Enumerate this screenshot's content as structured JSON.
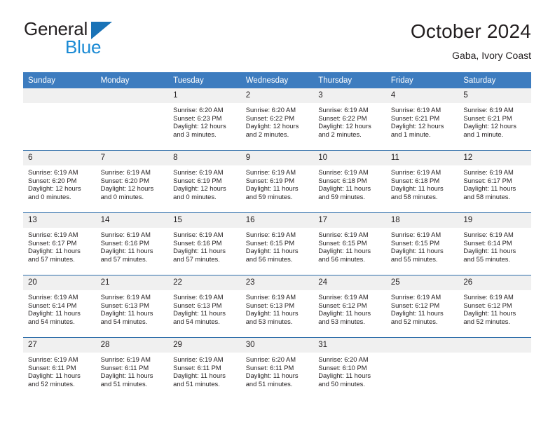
{
  "brand": {
    "name_part1": "General",
    "name_part2": "Blue",
    "triangle_color": "#1a73b7",
    "blue_color": "#1a8ad4"
  },
  "header": {
    "title": "October 2024",
    "subtitle": "Gaba, Ivory Coast"
  },
  "theme": {
    "header_bg": "#3d7cbf",
    "row_border": "#2c6ca8",
    "daynum_bg": "#f0f0f0",
    "text": "#231f20"
  },
  "calendar": {
    "weekdays": [
      "Sunday",
      "Monday",
      "Tuesday",
      "Wednesday",
      "Thursday",
      "Friday",
      "Saturday"
    ],
    "weeks": [
      [
        {
          "day": "",
          "empty": true
        },
        {
          "day": "",
          "empty": true
        },
        {
          "day": "1",
          "sunrise": "Sunrise: 6:20 AM",
          "sunset": "Sunset: 6:23 PM",
          "daylight_l1": "Daylight: 12 hours",
          "daylight_l2": "and 3 minutes."
        },
        {
          "day": "2",
          "sunrise": "Sunrise: 6:20 AM",
          "sunset": "Sunset: 6:22 PM",
          "daylight_l1": "Daylight: 12 hours",
          "daylight_l2": "and 2 minutes."
        },
        {
          "day": "3",
          "sunrise": "Sunrise: 6:19 AM",
          "sunset": "Sunset: 6:22 PM",
          "daylight_l1": "Daylight: 12 hours",
          "daylight_l2": "and 2 minutes."
        },
        {
          "day": "4",
          "sunrise": "Sunrise: 6:19 AM",
          "sunset": "Sunset: 6:21 PM",
          "daylight_l1": "Daylight: 12 hours",
          "daylight_l2": "and 1 minute."
        },
        {
          "day": "5",
          "sunrise": "Sunrise: 6:19 AM",
          "sunset": "Sunset: 6:21 PM",
          "daylight_l1": "Daylight: 12 hours",
          "daylight_l2": "and 1 minute."
        }
      ],
      [
        {
          "day": "6",
          "sunrise": "Sunrise: 6:19 AM",
          "sunset": "Sunset: 6:20 PM",
          "daylight_l1": "Daylight: 12 hours",
          "daylight_l2": "and 0 minutes."
        },
        {
          "day": "7",
          "sunrise": "Sunrise: 6:19 AM",
          "sunset": "Sunset: 6:20 PM",
          "daylight_l1": "Daylight: 12 hours",
          "daylight_l2": "and 0 minutes."
        },
        {
          "day": "8",
          "sunrise": "Sunrise: 6:19 AM",
          "sunset": "Sunset: 6:19 PM",
          "daylight_l1": "Daylight: 12 hours",
          "daylight_l2": "and 0 minutes."
        },
        {
          "day": "9",
          "sunrise": "Sunrise: 6:19 AM",
          "sunset": "Sunset: 6:19 PM",
          "daylight_l1": "Daylight: 11 hours",
          "daylight_l2": "and 59 minutes."
        },
        {
          "day": "10",
          "sunrise": "Sunrise: 6:19 AM",
          "sunset": "Sunset: 6:18 PM",
          "daylight_l1": "Daylight: 11 hours",
          "daylight_l2": "and 59 minutes."
        },
        {
          "day": "11",
          "sunrise": "Sunrise: 6:19 AM",
          "sunset": "Sunset: 6:18 PM",
          "daylight_l1": "Daylight: 11 hours",
          "daylight_l2": "and 58 minutes."
        },
        {
          "day": "12",
          "sunrise": "Sunrise: 6:19 AM",
          "sunset": "Sunset: 6:17 PM",
          "daylight_l1": "Daylight: 11 hours",
          "daylight_l2": "and 58 minutes."
        }
      ],
      [
        {
          "day": "13",
          "sunrise": "Sunrise: 6:19 AM",
          "sunset": "Sunset: 6:17 PM",
          "daylight_l1": "Daylight: 11 hours",
          "daylight_l2": "and 57 minutes."
        },
        {
          "day": "14",
          "sunrise": "Sunrise: 6:19 AM",
          "sunset": "Sunset: 6:16 PM",
          "daylight_l1": "Daylight: 11 hours",
          "daylight_l2": "and 57 minutes."
        },
        {
          "day": "15",
          "sunrise": "Sunrise: 6:19 AM",
          "sunset": "Sunset: 6:16 PM",
          "daylight_l1": "Daylight: 11 hours",
          "daylight_l2": "and 57 minutes."
        },
        {
          "day": "16",
          "sunrise": "Sunrise: 6:19 AM",
          "sunset": "Sunset: 6:15 PM",
          "daylight_l1": "Daylight: 11 hours",
          "daylight_l2": "and 56 minutes."
        },
        {
          "day": "17",
          "sunrise": "Sunrise: 6:19 AM",
          "sunset": "Sunset: 6:15 PM",
          "daylight_l1": "Daylight: 11 hours",
          "daylight_l2": "and 56 minutes."
        },
        {
          "day": "18",
          "sunrise": "Sunrise: 6:19 AM",
          "sunset": "Sunset: 6:15 PM",
          "daylight_l1": "Daylight: 11 hours",
          "daylight_l2": "and 55 minutes."
        },
        {
          "day": "19",
          "sunrise": "Sunrise: 6:19 AM",
          "sunset": "Sunset: 6:14 PM",
          "daylight_l1": "Daylight: 11 hours",
          "daylight_l2": "and 55 minutes."
        }
      ],
      [
        {
          "day": "20",
          "sunrise": "Sunrise: 6:19 AM",
          "sunset": "Sunset: 6:14 PM",
          "daylight_l1": "Daylight: 11 hours",
          "daylight_l2": "and 54 minutes."
        },
        {
          "day": "21",
          "sunrise": "Sunrise: 6:19 AM",
          "sunset": "Sunset: 6:13 PM",
          "daylight_l1": "Daylight: 11 hours",
          "daylight_l2": "and 54 minutes."
        },
        {
          "day": "22",
          "sunrise": "Sunrise: 6:19 AM",
          "sunset": "Sunset: 6:13 PM",
          "daylight_l1": "Daylight: 11 hours",
          "daylight_l2": "and 54 minutes."
        },
        {
          "day": "23",
          "sunrise": "Sunrise: 6:19 AM",
          "sunset": "Sunset: 6:13 PM",
          "daylight_l1": "Daylight: 11 hours",
          "daylight_l2": "and 53 minutes."
        },
        {
          "day": "24",
          "sunrise": "Sunrise: 6:19 AM",
          "sunset": "Sunset: 6:12 PM",
          "daylight_l1": "Daylight: 11 hours",
          "daylight_l2": "and 53 minutes."
        },
        {
          "day": "25",
          "sunrise": "Sunrise: 6:19 AM",
          "sunset": "Sunset: 6:12 PM",
          "daylight_l1": "Daylight: 11 hours",
          "daylight_l2": "and 52 minutes."
        },
        {
          "day": "26",
          "sunrise": "Sunrise: 6:19 AM",
          "sunset": "Sunset: 6:12 PM",
          "daylight_l1": "Daylight: 11 hours",
          "daylight_l2": "and 52 minutes."
        }
      ],
      [
        {
          "day": "27",
          "sunrise": "Sunrise: 6:19 AM",
          "sunset": "Sunset: 6:11 PM",
          "daylight_l1": "Daylight: 11 hours",
          "daylight_l2": "and 52 minutes."
        },
        {
          "day": "28",
          "sunrise": "Sunrise: 6:19 AM",
          "sunset": "Sunset: 6:11 PM",
          "daylight_l1": "Daylight: 11 hours",
          "daylight_l2": "and 51 minutes."
        },
        {
          "day": "29",
          "sunrise": "Sunrise: 6:19 AM",
          "sunset": "Sunset: 6:11 PM",
          "daylight_l1": "Daylight: 11 hours",
          "daylight_l2": "and 51 minutes."
        },
        {
          "day": "30",
          "sunrise": "Sunrise: 6:20 AM",
          "sunset": "Sunset: 6:11 PM",
          "daylight_l1": "Daylight: 11 hours",
          "daylight_l2": "and 51 minutes."
        },
        {
          "day": "31",
          "sunrise": "Sunrise: 6:20 AM",
          "sunset": "Sunset: 6:10 PM",
          "daylight_l1": "Daylight: 11 hours",
          "daylight_l2": "and 50 minutes."
        },
        {
          "day": "",
          "empty": true
        },
        {
          "day": "",
          "empty": true
        }
      ]
    ]
  }
}
